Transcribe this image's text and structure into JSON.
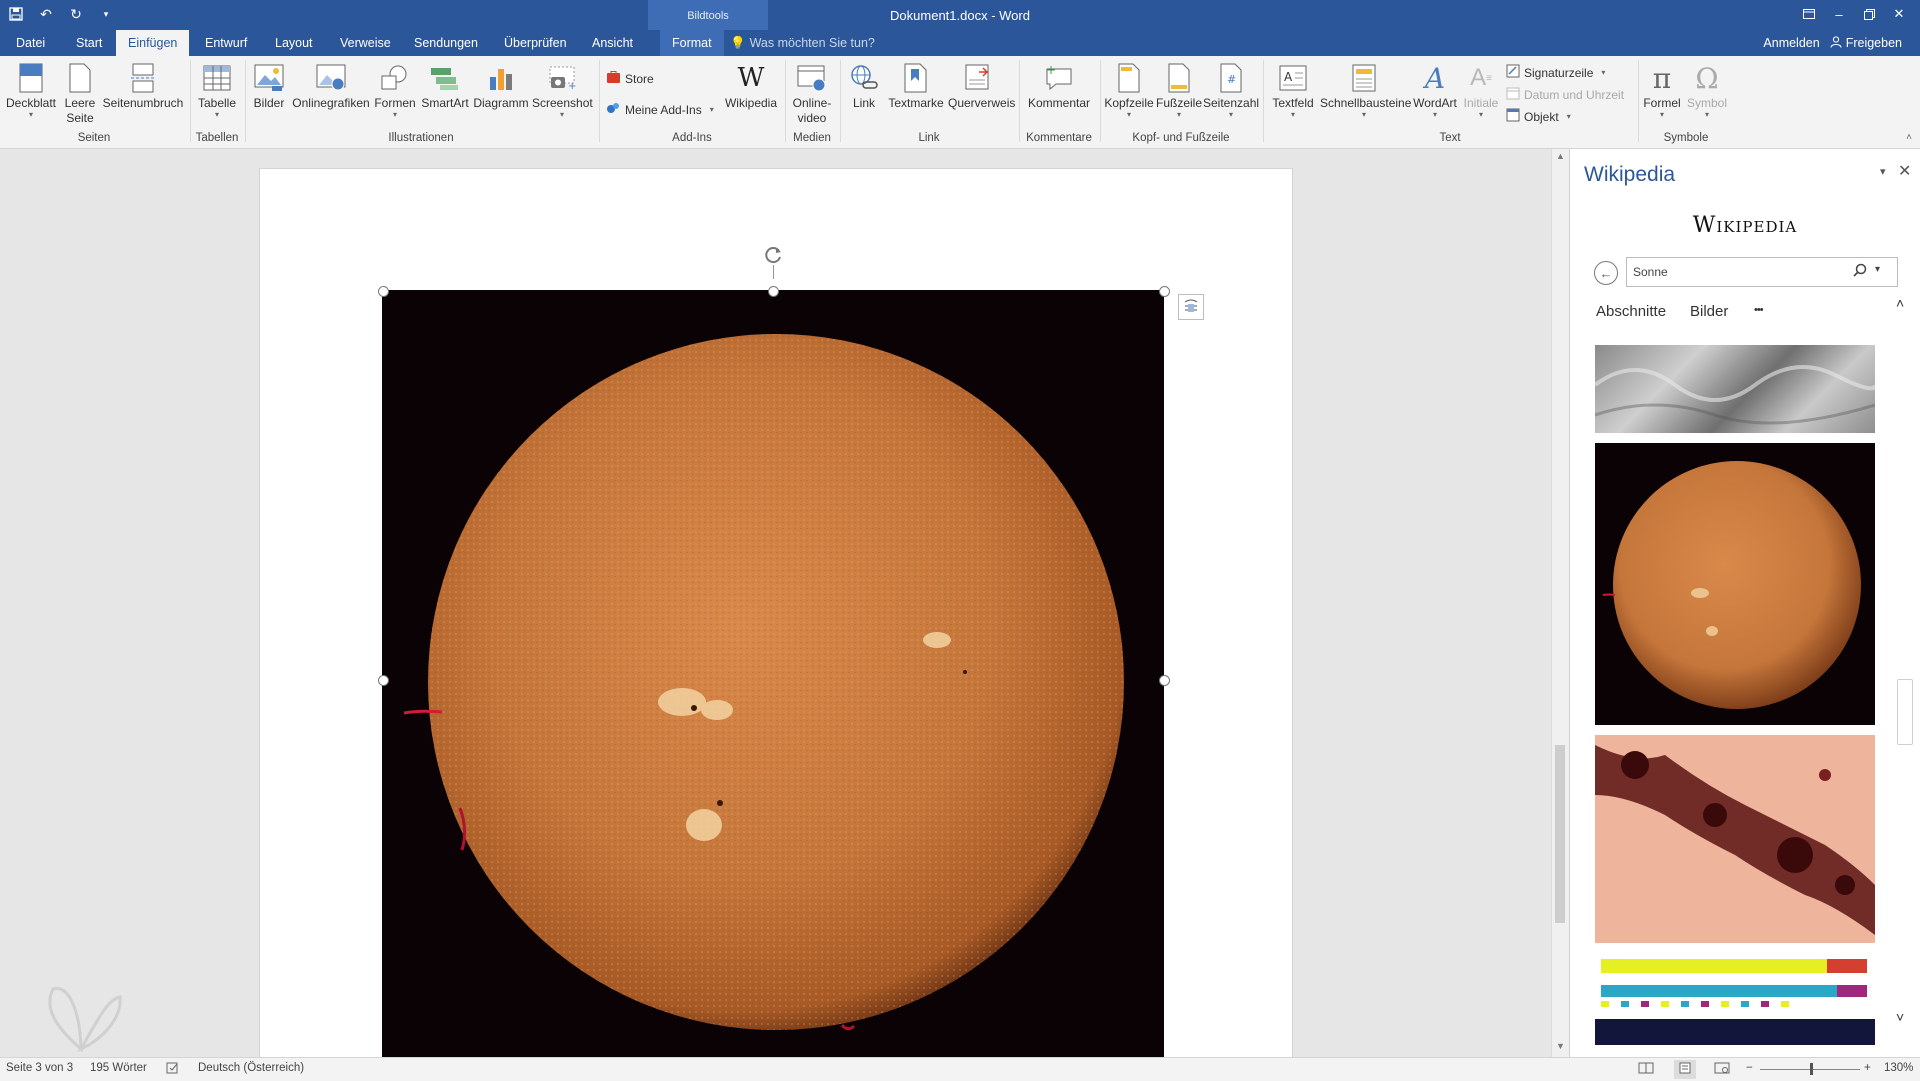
{
  "titlebar": {
    "contextual_label": "Bildtools",
    "document_title": "Dokument1.docx - Word"
  },
  "tabs": [
    "Datei",
    "Start",
    "Einfügen",
    "Entwurf",
    "Layout",
    "Verweise",
    "Sendungen",
    "Überprüfen",
    "Ansicht",
    "Format"
  ],
  "active_tab": "Einfügen",
  "tellme_placeholder": "Was möchten Sie tun?",
  "account": {
    "signin": "Anmelden",
    "share": "Freigeben"
  },
  "ribbon": {
    "groups": [
      "Seiten",
      "Tabellen",
      "Illustrationen",
      "Add-Ins",
      "Medien",
      "Link",
      "Kommentare",
      "Kopf- und Fußzeile",
      "Text",
      "Symbole"
    ],
    "pages": {
      "cover": "Deckblatt",
      "blank_line1": "Leere",
      "blank_line2": "Seite",
      "pagebreak": "Seitenumbruch"
    },
    "tables": {
      "table": "Tabelle"
    },
    "illustrations": {
      "pictures": "Bilder",
      "online": "Onlinegrafiken",
      "shapes": "Formen",
      "smartart": "SmartArt",
      "chart": "Diagramm",
      "screenshot": "Screenshot"
    },
    "addins": {
      "store": "Store",
      "myaddins": "Meine Add-Ins",
      "wikipedia": "Wikipedia"
    },
    "media": {
      "video_line1": "Online-",
      "video_line2": "video"
    },
    "links": {
      "link": "Link",
      "bookmark": "Textmarke",
      "crossref": "Querverweis"
    },
    "comments": {
      "comment": "Kommentar"
    },
    "headerfooter": {
      "header": "Kopfzeile",
      "footer": "Fußzeile",
      "pagenumber": "Seitenzahl"
    },
    "text": {
      "textbox": "Textfeld",
      "quickparts": "Schnellbausteine",
      "wordart": "WordArt",
      "dropcap": "Initiale",
      "signature": "Signaturzeile",
      "datetime": "Datum und Uhrzeit",
      "object": "Objekt"
    },
    "symbols": {
      "equation": "Formel",
      "symbol": "Symbol"
    }
  },
  "pane": {
    "title": "Wikipedia",
    "logo": "Wikipedia",
    "search_value": "Sonne",
    "nav": [
      "Abschnitte",
      "Bilder"
    ],
    "more": "•••"
  },
  "statusbar": {
    "page": "Seite 3 von 3",
    "words": "195 Wörter",
    "language": "Deutsch (Österreich)",
    "zoom": "130%"
  },
  "colors": {
    "word_blue": "#2b579a",
    "ribbon_bg": "#f3f3f3",
    "sun": "#c8783a"
  }
}
